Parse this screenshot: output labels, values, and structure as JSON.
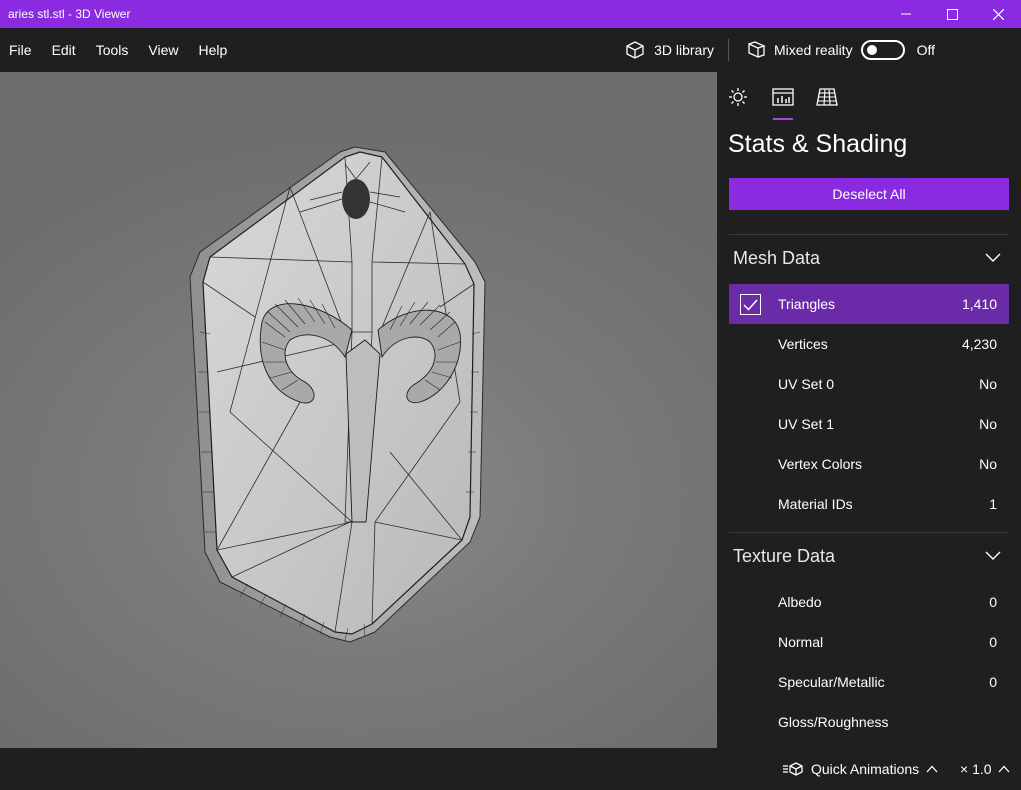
{
  "window": {
    "title": "aries stl.stl - 3D Viewer"
  },
  "menu": {
    "items": [
      "File",
      "Edit",
      "Tools",
      "View",
      "Help"
    ],
    "library_label": "3D library",
    "mixed_reality_label": "Mixed reality",
    "mixed_reality_state": "Off"
  },
  "panel": {
    "tabs": [
      "sun-icon",
      "stats-icon",
      "grid-icon"
    ],
    "active_tab": "stats-icon",
    "title": "Stats & Shading",
    "deselect_label": "Deselect All",
    "mesh_section": "Mesh Data",
    "mesh_rows": [
      {
        "label": "Triangles",
        "value": "1,410",
        "checked": true
      },
      {
        "label": "Vertices",
        "value": "4,230"
      },
      {
        "label": "UV Set 0",
        "value": "No"
      },
      {
        "label": "UV Set 1",
        "value": "No"
      },
      {
        "label": "Vertex Colors",
        "value": "No"
      },
      {
        "label": "Material IDs",
        "value": "1"
      }
    ],
    "texture_section": "Texture Data",
    "texture_rows": [
      {
        "label": "Albedo",
        "value": "0"
      },
      {
        "label": "Normal",
        "value": "0"
      },
      {
        "label": "Specular/Metallic",
        "value": "0"
      },
      {
        "label": "Gloss/Roughness",
        "value": ""
      }
    ]
  },
  "bottom": {
    "quick_animations_label": "Quick Animations",
    "speed_label": "× 1.0"
  },
  "colors": {
    "accent": "#8a2be2",
    "selected_row": "#6b2aa8",
    "background": "#1f1f1f"
  }
}
